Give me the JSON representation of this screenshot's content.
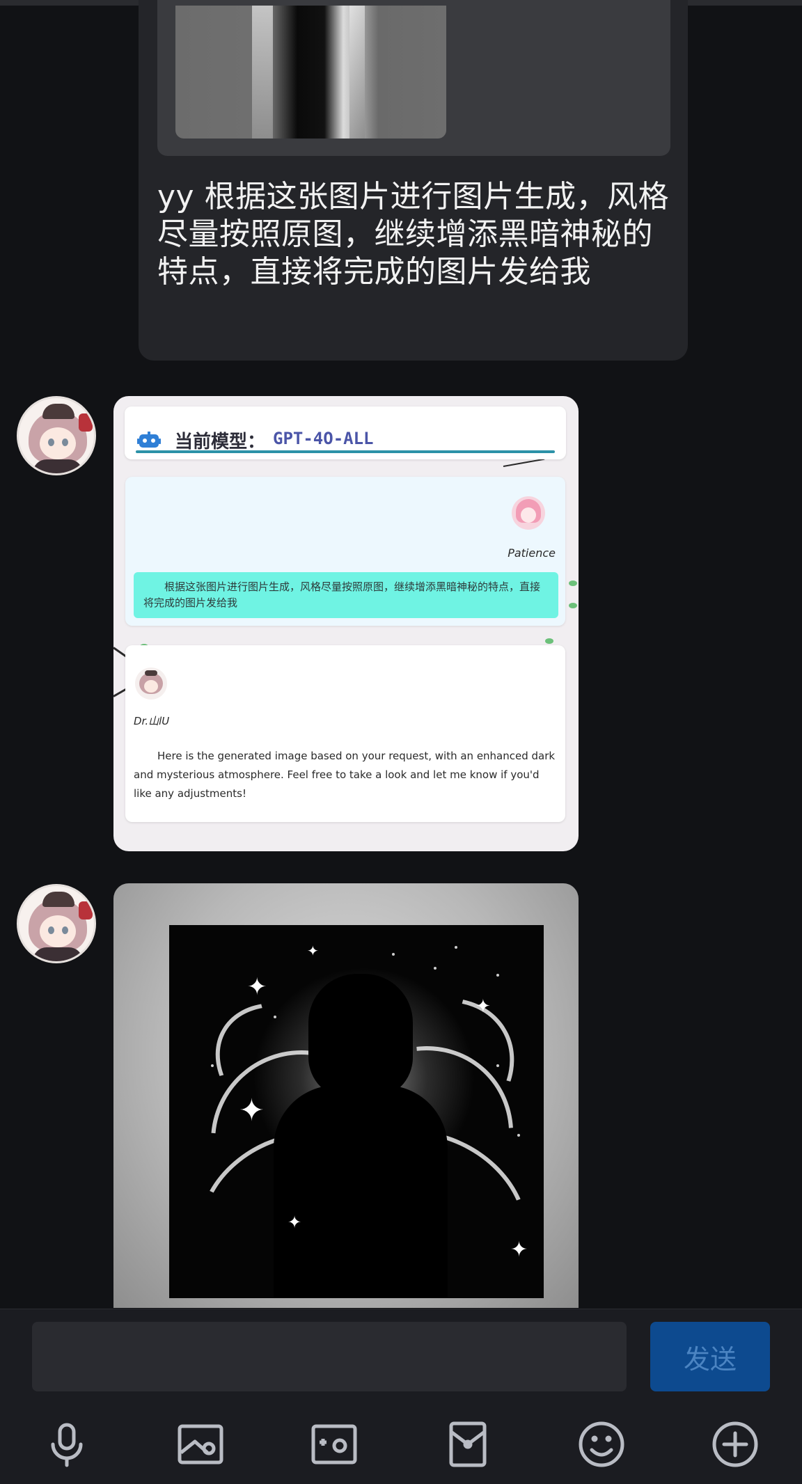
{
  "conversation": {
    "user_message": {
      "text": "yy 根据这张图片进行图片生成，风格尽量按照原图，继续增添黑暗神秘的特点，直接将完成的图片发给我"
    },
    "bot_card": {
      "model_label": "当前模型：",
      "model_name": "GPT-4O-ALL",
      "request_author": "Patience",
      "request_text": "根据这张图片进行图片生成，风格尽量按照原图，继续增添黑暗神秘的特点，直接将完成的图片发给我",
      "response_author": "Dr.山lU",
      "response_text": "Here is the generated image based on your request, with an enhanced dark and mysterious atmosphere. Feel free to take a look and let me know if you'd like any adjustments!"
    }
  },
  "composer": {
    "input_value": "",
    "input_placeholder": "",
    "send_label": "发送",
    "tools": [
      {
        "icon": "microphone-icon"
      },
      {
        "icon": "image-icon"
      },
      {
        "icon": "camera-icon"
      },
      {
        "icon": "red-packet-icon"
      },
      {
        "icon": "emoji-icon"
      },
      {
        "icon": "plus-circle-icon"
      }
    ]
  },
  "colors": {
    "background": "#111215",
    "user_bubble": "#242529",
    "send_button": "#0d4a8f",
    "model_accent": "#2c92a8",
    "request_highlight": "#6ff3e3"
  }
}
